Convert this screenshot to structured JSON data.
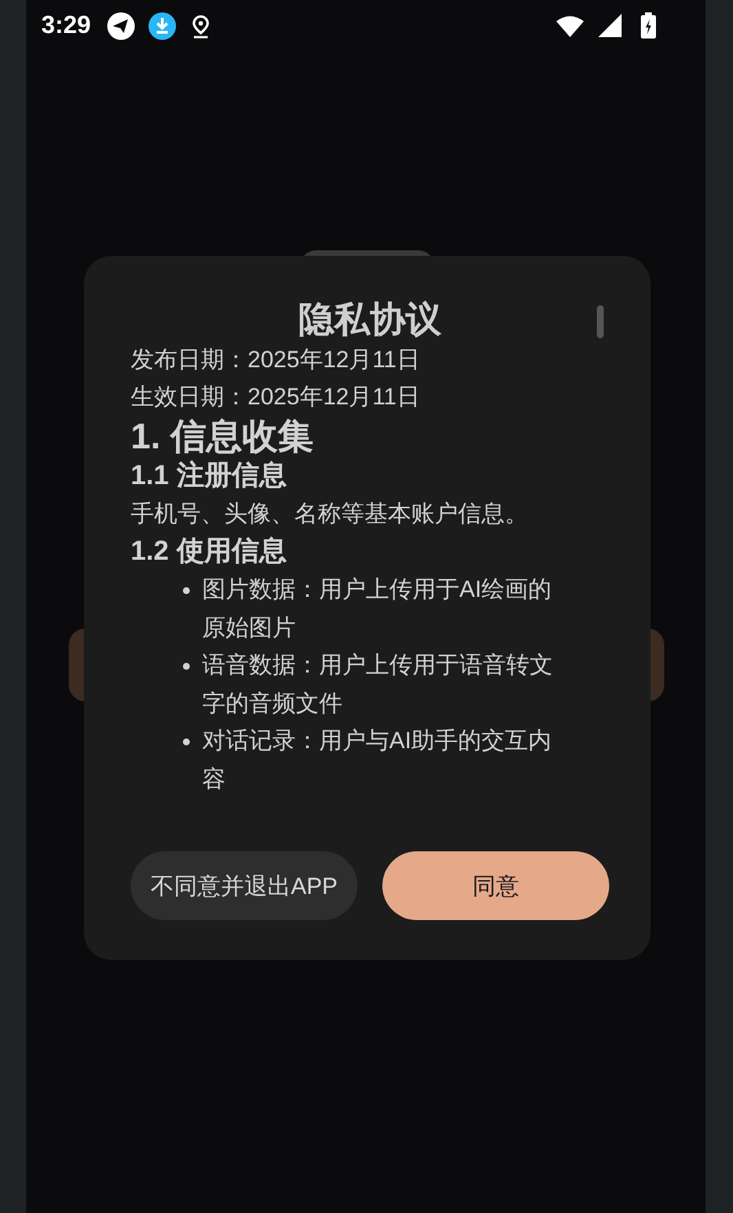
{
  "status_bar": {
    "time": "3:29"
  },
  "dialog": {
    "title": "隐私协议",
    "content": [
      {
        "kind": "paragraph",
        "text": "发布日期：2025年12月11日"
      },
      {
        "kind": "paragraph",
        "text": "生效日期：2025年12月11日"
      },
      {
        "kind": "heading1",
        "text": "1. 信息收集"
      },
      {
        "kind": "heading2",
        "text": "1.1 注册信息"
      },
      {
        "kind": "paragraph",
        "text": "手机号、头像、名称等基本账户信息。"
      },
      {
        "kind": "heading2",
        "text": "1.2 使用信息"
      },
      {
        "kind": "bullet",
        "text": "图片数据：用户上传用于AI绘画的原始图片"
      },
      {
        "kind": "bullet",
        "text": "语音数据：用户上传用于语音转文字的音频文件"
      },
      {
        "kind": "bullet",
        "text": "对话记录：用户与AI助手的交互内容"
      }
    ],
    "buttons": [
      {
        "label": "不同意并退出APP",
        "kind": "secondary"
      },
      {
        "label": "同意",
        "kind": "primary"
      }
    ]
  }
}
